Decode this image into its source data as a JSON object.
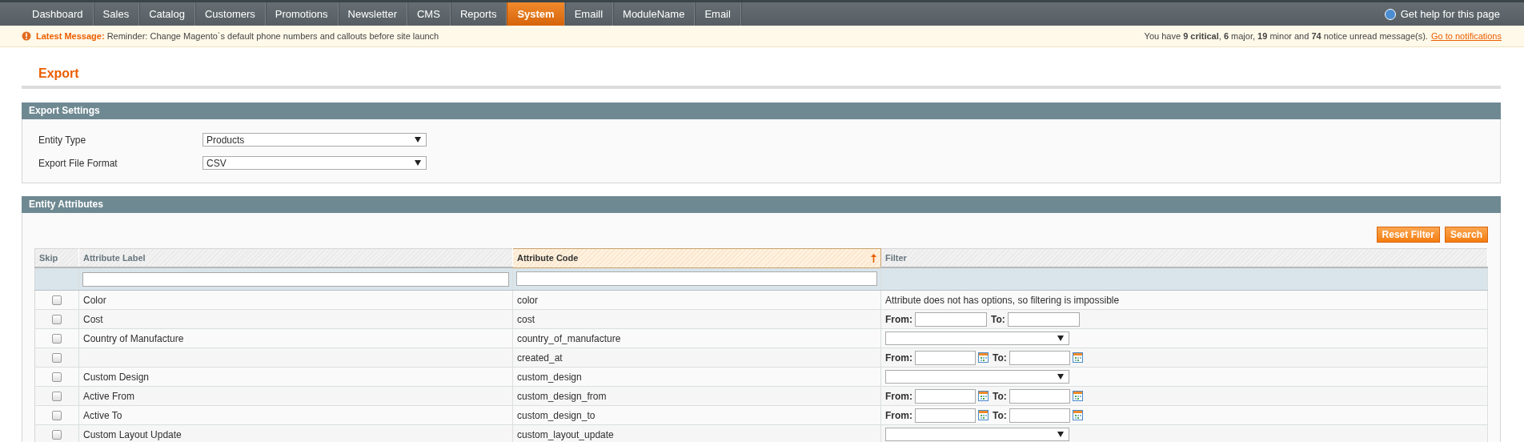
{
  "nav": {
    "tabs": [
      {
        "label": "Dashboard",
        "selected": false
      },
      {
        "label": "Sales",
        "selected": false
      },
      {
        "label": "Catalog",
        "selected": false
      },
      {
        "label": "Customers",
        "selected": false
      },
      {
        "label": "Promotions",
        "selected": false
      },
      {
        "label": "Newsletter",
        "selected": false
      },
      {
        "label": "CMS",
        "selected": false
      },
      {
        "label": "Reports",
        "selected": false
      },
      {
        "label": "System",
        "selected": true
      },
      {
        "label": "Emaill",
        "selected": false
      },
      {
        "label": "ModuleName",
        "selected": false
      },
      {
        "label": "Email",
        "selected": false
      }
    ],
    "help": "Get help for this page"
  },
  "notice": {
    "latest": "**Latest Message:** Reminder: Change Magento`s default phone numbers and callouts before site launch",
    "summary": "You have **9 critical**, **6** major, **19** minor and **74** notice unread message(s).",
    "link": "Go to notifications"
  },
  "page": {
    "title": "Export"
  },
  "export_settings": {
    "title": "Export Settings",
    "fields": [
      {
        "label": "Entity Type",
        "value": "Products"
      },
      {
        "label": "Export File Format",
        "value": "CSV"
      }
    ]
  },
  "entity_attributes": {
    "title": "Entity Attributes",
    "buttons": [
      "Reset Filter",
      "Search"
    ],
    "columns": [
      {
        "label": "Skip",
        "sorted": false,
        "filterable": false
      },
      {
        "label": "Attribute Label",
        "sorted": false,
        "filterable": true
      },
      {
        "label": "Attribute Code",
        "sorted": true,
        "filterable": true
      },
      {
        "label": "Filter",
        "sorted": false,
        "filterable": false
      }
    ],
    "rows": [
      {
        "skip": false,
        "label": "Color",
        "code": "color",
        "filter": {
          "kind": "message",
          "text": "Attribute does not has options, so filtering is impossible"
        }
      },
      {
        "skip": false,
        "label": "Cost",
        "code": "cost",
        "filter": {
          "kind": "range",
          "from": "From:",
          "to": "To:"
        }
      },
      {
        "skip": false,
        "label": "Country of Manufacture",
        "code": "country_of_manufacture",
        "filter": {
          "kind": "select"
        }
      },
      {
        "skip": false,
        "code": "created_at",
        "filter": {
          "kind": "date_range",
          "from": "From:",
          "to": "To:"
        }
      },
      {
        "skip": false,
        "label": "Custom Design",
        "code": "custom_design",
        "filter": {
          "kind": "select"
        }
      },
      {
        "skip": false,
        "label": "Active From",
        "code": "custom_design_from",
        "filter": {
          "kind": "date_range",
          "from": "From:",
          "to": "To:"
        }
      },
      {
        "skip": false,
        "label": "Active To",
        "code": "custom_design_to",
        "filter": {
          "kind": "date_range",
          "from": "From:",
          "to": "To:"
        }
      },
      {
        "skip": false,
        "label": "Custom Layout Update",
        "code": "custom_layout_update",
        "filter": {
          "kind": "select"
        }
      }
    ]
  }
}
